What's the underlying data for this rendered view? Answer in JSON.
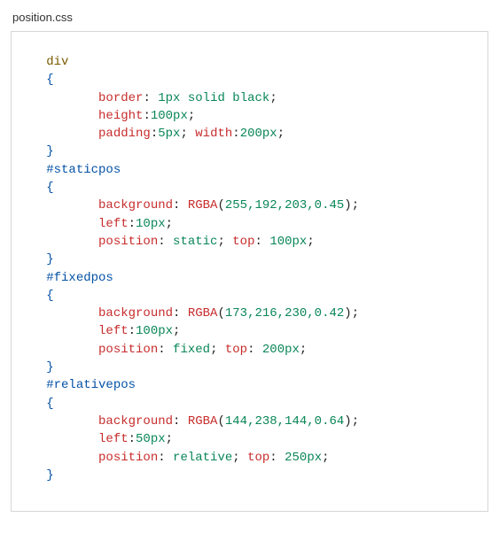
{
  "file": {
    "name": "position.css"
  },
  "code": {
    "rules": [
      {
        "selector": "div",
        "selectorKind": "type",
        "declarationLines": [
          [
            {
              "prop": "border",
              "segments": [
                {
                  "t": "num",
                  "v": "1px"
                },
                {
                  "t": "space"
                },
                {
                  "t": "ident",
                  "v": "solid"
                },
                {
                  "t": "space"
                },
                {
                  "t": "ident",
                  "v": "black"
                }
              ]
            }
          ],
          [
            {
              "prop": "height",
              "segments": [
                {
                  "t": "num",
                  "v": "100px"
                }
              ]
            }
          ],
          [
            {
              "prop": "padding",
              "segments": [
                {
                  "t": "num",
                  "v": "5px"
                }
              ]
            },
            {
              "prop": "width",
              "segments": [
                {
                  "t": "num",
                  "v": "200px"
                }
              ]
            }
          ]
        ]
      },
      {
        "selector": "#staticpos",
        "selectorKind": "id",
        "declarationLines": [
          [
            {
              "prop": "background",
              "segments": [
                {
                  "t": "func",
                  "name": "RGBA",
                  "args": "255,192,203,0.45"
                }
              ]
            }
          ],
          [
            {
              "prop": "left",
              "segments": [
                {
                  "t": "num",
                  "v": "10px"
                }
              ]
            }
          ],
          [
            {
              "prop": "position",
              "segments": [
                {
                  "t": "ident",
                  "v": "static"
                }
              ]
            },
            {
              "prop": "top",
              "segments": [
                {
                  "t": "num",
                  "v": "100px"
                }
              ]
            }
          ]
        ]
      },
      {
        "selector": "#fixedpos",
        "selectorKind": "id",
        "declarationLines": [
          [
            {
              "prop": "background",
              "segments": [
                {
                  "t": "func",
                  "name": "RGBA",
                  "args": "173,216,230,0.42"
                }
              ]
            }
          ],
          [
            {
              "prop": "left",
              "segments": [
                {
                  "t": "num",
                  "v": "100px"
                }
              ]
            }
          ],
          [
            {
              "prop": "position",
              "segments": [
                {
                  "t": "ident",
                  "v": "fixed"
                }
              ]
            },
            {
              "prop": "top",
              "segments": [
                {
                  "t": "num",
                  "v": "200px"
                }
              ]
            }
          ]
        ]
      },
      {
        "selector": "#relativepos",
        "selectorKind": "id",
        "declarationLines": [
          [
            {
              "prop": "background",
              "segments": [
                {
                  "t": "func",
                  "name": "RGBA",
                  "args": "144,238,144,0.64"
                }
              ]
            }
          ],
          [
            {
              "prop": "left",
              "segments": [
                {
                  "t": "num",
                  "v": "50px"
                }
              ]
            }
          ],
          [
            {
              "prop": "position",
              "segments": [
                {
                  "t": "ident",
                  "v": "relative"
                }
              ]
            },
            {
              "prop": "top",
              "segments": [
                {
                  "t": "num",
                  "v": "250px"
                }
              ]
            }
          ]
        ]
      }
    ]
  }
}
